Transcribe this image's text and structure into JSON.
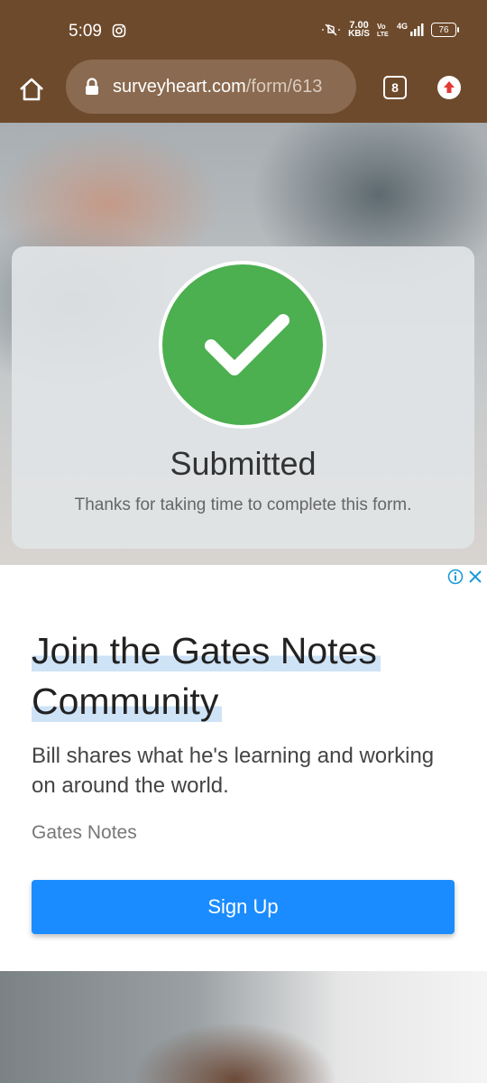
{
  "status_bar": {
    "time": "5:09",
    "speed_value": "7.00",
    "speed_unit": "KB/S",
    "network": "4G",
    "battery": "76"
  },
  "browser": {
    "url_domain": "surveyheart.com",
    "url_path": "/form/613",
    "tab_count": "8"
  },
  "confirmation": {
    "title": "Submitted",
    "message": "Thanks for taking time to complete this form."
  },
  "ad": {
    "headline_line1": "Join the Gates Notes",
    "headline_line2": "Community",
    "body": "Bill shares what he's learning and working on around the world.",
    "advertiser": "Gates Notes",
    "cta_label": "Sign Up",
    "accent_color": "#1a8cff"
  },
  "colors": {
    "browser_chrome": "#6e4a2c",
    "success_green": "#4caf50"
  },
  "icons": [
    "instagram-icon",
    "mute-icon",
    "volte-icon",
    "signal-icon",
    "battery-icon",
    "home-icon",
    "lock-icon",
    "tabs-icon",
    "upload-icon",
    "check-icon",
    "ad-info-icon",
    "ad-close-icon"
  ]
}
